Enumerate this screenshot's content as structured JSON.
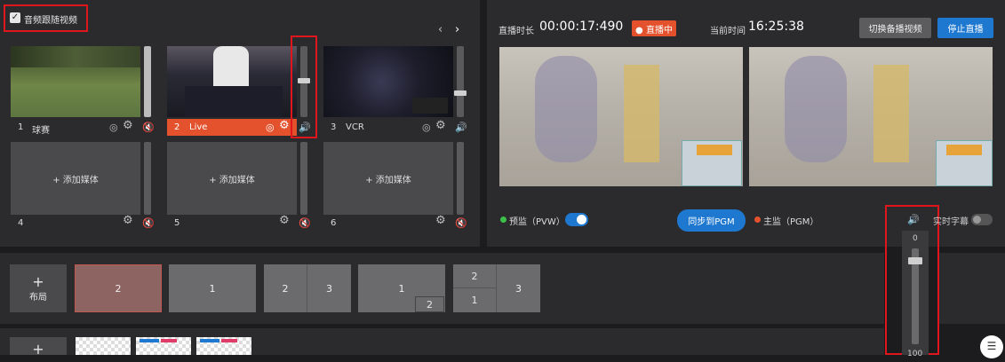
{
  "audio_follow": {
    "label": "音频跟随视频",
    "checked": true
  },
  "sources": [
    {
      "index": "1",
      "name": "球赛"
    },
    {
      "index": "2",
      "name": "Live"
    },
    {
      "index": "3",
      "name": "VCR"
    }
  ],
  "empty_sources": [
    {
      "index": "4",
      "label": "+ 添加媒体"
    },
    {
      "index": "5",
      "label": "+ 添加媒体"
    },
    {
      "index": "6",
      "label": "+ 添加媒体"
    }
  ],
  "header": {
    "duration_label": "直播时长",
    "duration_value": "00:00:17:490",
    "live_badge": "● 直播中",
    "time_label": "当前时间",
    "time_value": "16:25:38",
    "switch_backup": "切换备播视频",
    "stop_live": "停止直播"
  },
  "preview_label": "预监（PVW）",
  "program_label": "主监（PGM）",
  "sync_button": "同步到PGM",
  "subtitle_label": "实时字幕",
  "master_volume": {
    "top": "0",
    "bottom": "100"
  },
  "layout_add": {
    "plus": "+",
    "label": "布局"
  },
  "layouts": {
    "l1": "2",
    "l2": "1",
    "l3a": "2",
    "l3b": "3",
    "l4a": "1",
    "l4b": "2",
    "l5a": "2",
    "l5b": "1",
    "l5c": "3"
  },
  "overlay_add": "+",
  "colors": {
    "accent": "#0f7de2",
    "live": "#e3522c",
    "danger": "#e0161d",
    "stop": "#1e78d0"
  }
}
